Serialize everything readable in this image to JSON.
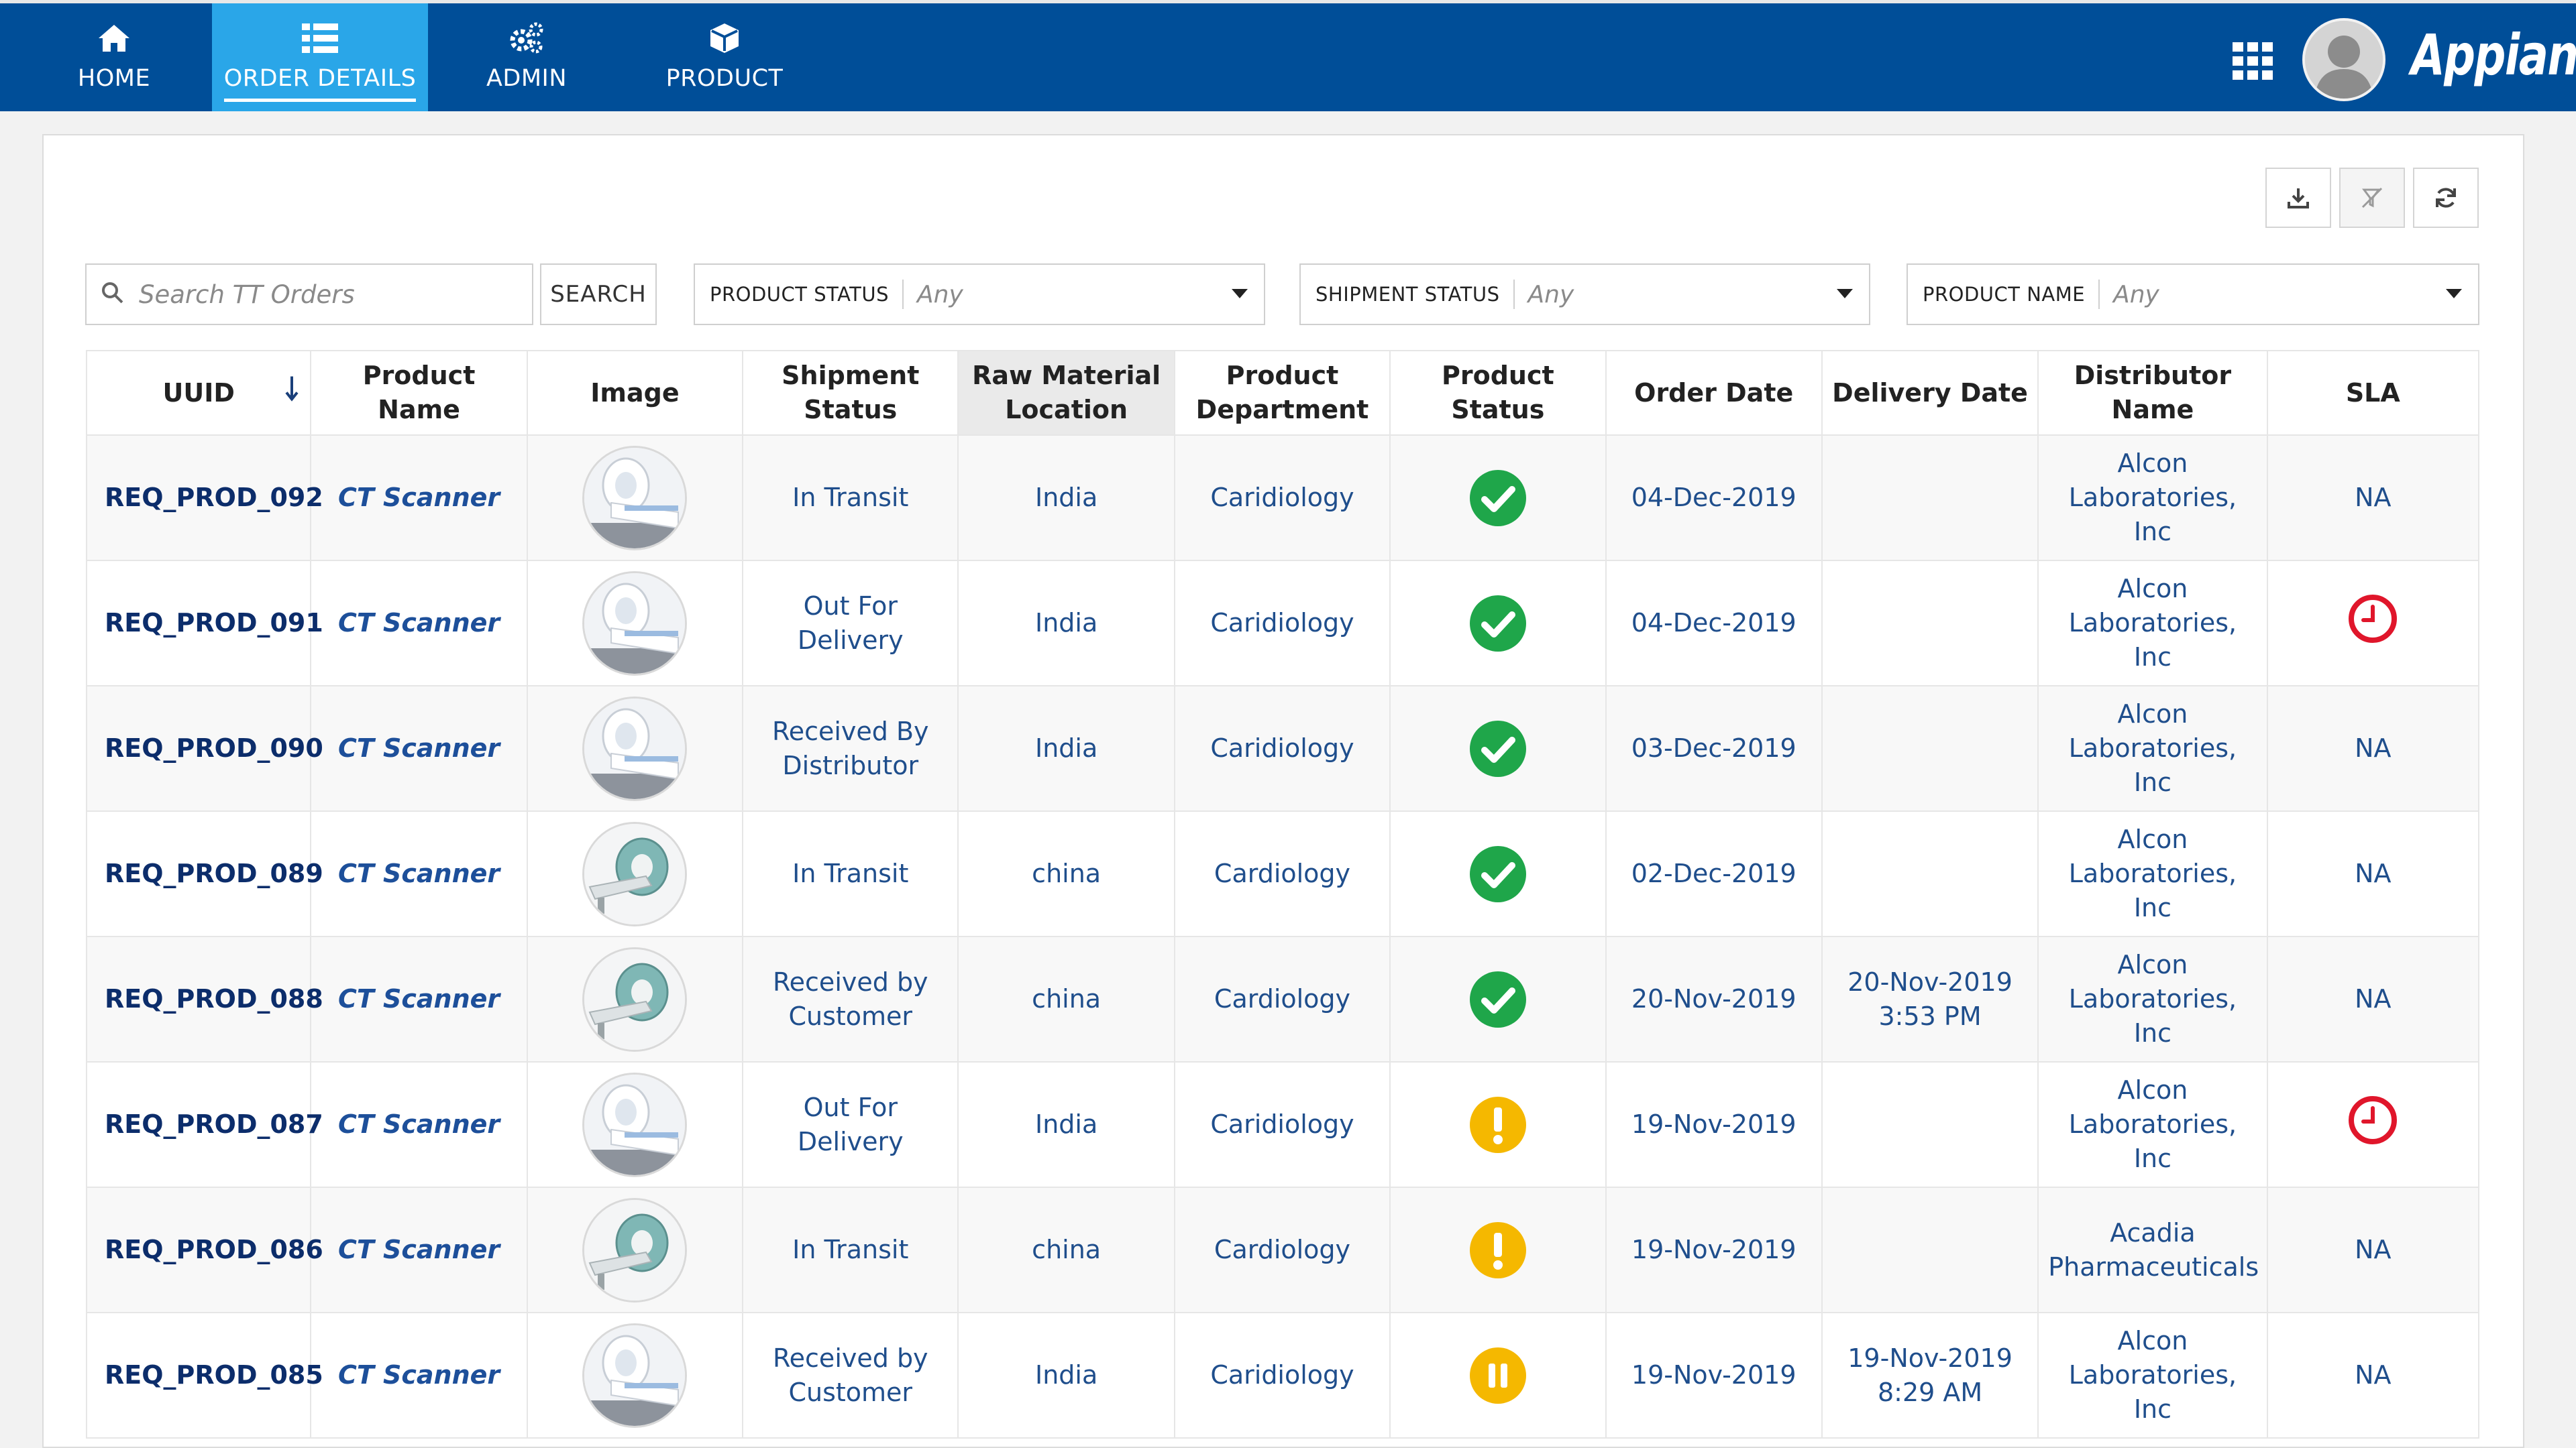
{
  "nav": {
    "tabs": [
      {
        "label": "HOME",
        "icon": "home-icon"
      },
      {
        "label": "ORDER DETAILS",
        "icon": "list-icon",
        "active": true
      },
      {
        "label": "ADMIN",
        "icon": "gears-icon"
      },
      {
        "label": "PRODUCT",
        "icon": "cube-icon"
      }
    ],
    "brand": "Appian"
  },
  "search": {
    "placeholder": "Search TT Orders",
    "button_label": "SEARCH"
  },
  "filters": [
    {
      "label": "PRODUCT STATUS",
      "value": "Any"
    },
    {
      "label": "SHIPMENT STATUS",
      "value": "Any"
    },
    {
      "label": "PRODUCT NAME",
      "value": "Any"
    }
  ],
  "table": {
    "headers": [
      "UUID",
      "Product Name",
      "Image",
      "Shipment Status",
      "Raw Material Location",
      "Product Department",
      "Product Status",
      "Order Date",
      "Delivery Date",
      "Distributor Name",
      "SLA"
    ],
    "rows": [
      {
        "uuid": "REQ_PROD_092",
        "product": "CT Scanner",
        "image": "scanner-white",
        "shipment": "In Transit",
        "location": "India",
        "department": "Caridiology",
        "status": "check",
        "order_date": "04-Dec-2019",
        "delivery": "",
        "distributor": "Alcon Laboratories, Inc",
        "sla": "NA"
      },
      {
        "uuid": "REQ_PROD_091",
        "product": "CT Scanner",
        "image": "scanner-white",
        "shipment": "Out For Delivery",
        "location": "India",
        "department": "Caridiology",
        "status": "check",
        "order_date": "04-Dec-2019",
        "delivery": "",
        "distributor": "Alcon Laboratories, Inc",
        "sla": "clock"
      },
      {
        "uuid": "REQ_PROD_090",
        "product": "CT Scanner",
        "image": "scanner-white",
        "shipment": "Received By Distributor",
        "location": "India",
        "department": "Caridiology",
        "status": "check",
        "order_date": "03-Dec-2019",
        "delivery": "",
        "distributor": "Alcon Laboratories, Inc",
        "sla": "NA"
      },
      {
        "uuid": "REQ_PROD_089",
        "product": "CT Scanner",
        "image": "scanner-teal",
        "shipment": "In Transit",
        "location": "china",
        "department": "Cardiology",
        "status": "check",
        "order_date": "02-Dec-2019",
        "delivery": "",
        "distributor": "Alcon Laboratories, Inc",
        "sla": "NA"
      },
      {
        "uuid": "REQ_PROD_088",
        "product": "CT Scanner",
        "image": "scanner-teal",
        "shipment": "Received by Customer",
        "location": "china",
        "department": "Cardiology",
        "status": "check",
        "order_date": "20-Nov-2019",
        "delivery": "20-Nov-2019 3:53 PM",
        "distributor": "Alcon Laboratories, Inc",
        "sla": "NA"
      },
      {
        "uuid": "REQ_PROD_087",
        "product": "CT Scanner",
        "image": "scanner-white",
        "shipment": "Out For Delivery",
        "location": "India",
        "department": "Caridiology",
        "status": "warning",
        "order_date": "19-Nov-2019",
        "delivery": "",
        "distributor": "Alcon Laboratories, Inc",
        "sla": "clock"
      },
      {
        "uuid": "REQ_PROD_086",
        "product": "CT Scanner",
        "image": "scanner-teal",
        "shipment": "In Transit",
        "location": "china",
        "department": "Cardiology",
        "status": "warning",
        "order_date": "19-Nov-2019",
        "delivery": "",
        "distributor": "Acadia Pharmaceuticals",
        "sla": "NA"
      },
      {
        "uuid": "REQ_PROD_085",
        "product": "CT Scanner",
        "image": "scanner-white",
        "shipment": "Received by Customer",
        "location": "India",
        "department": "Caridiology",
        "status": "paused",
        "order_date": "19-Nov-2019",
        "delivery": "19-Nov-2019 8:29 AM",
        "distributor": "Alcon Laboratories, Inc",
        "sla": "NA"
      }
    ]
  },
  "colors": {
    "nav_bg": "#004e98",
    "nav_active": "#2aa6e8",
    "check": "#1fa64a",
    "warning": "#f5b800",
    "sla_alert": "#e0162b"
  }
}
